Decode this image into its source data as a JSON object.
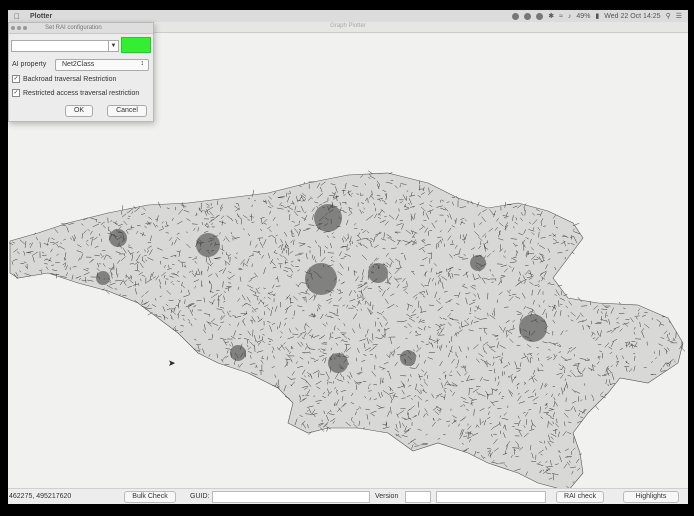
{
  "menubar": {
    "app_name": "Plotter",
    "clock": "Wed 22 Oct  14:25",
    "battery": "49%"
  },
  "window": {
    "title": "Graph Plotter"
  },
  "dialog": {
    "title": "Set RAI configuration",
    "color": "#33ee33",
    "property_label": "AI property",
    "property_value": "Net2Class",
    "checkboxes": [
      {
        "label": "Backroad traversal Restriction",
        "checked": true
      },
      {
        "label": "Restricted access traversal restriction",
        "checked": true
      }
    ],
    "ok_label": "OK",
    "cancel_label": "Cancel"
  },
  "statusbar": {
    "coordinates": "462275, 495217620",
    "bulk_check_label": "Bulk Check",
    "guid_label": "GUID:",
    "version_label": "Version",
    "rai_check_label": "RAI check",
    "highlights_label": "Highlights"
  },
  "map": {
    "color": "#3a3a3a"
  }
}
